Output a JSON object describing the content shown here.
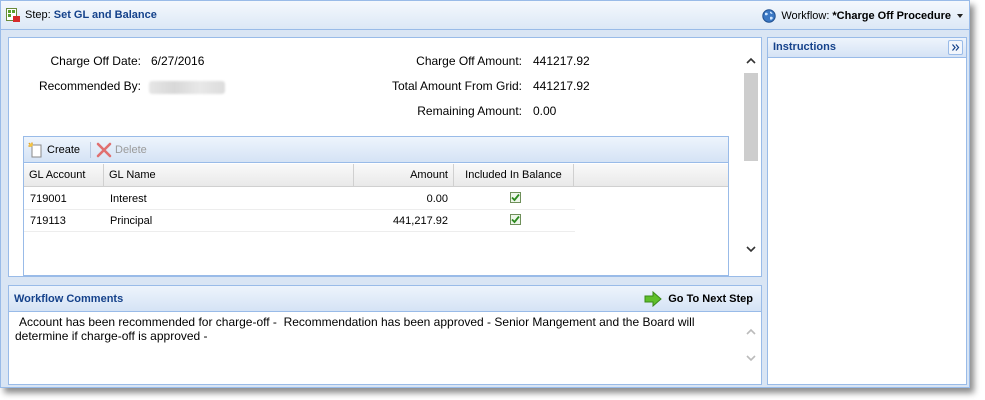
{
  "header": {
    "step_prefix": "Step:",
    "step_title": "Set GL and Balance",
    "workflow_label": "Workflow:",
    "workflow_name": "*Charge Off Procedure"
  },
  "summary": {
    "charge_off_date_label": "Charge Off Date:",
    "charge_off_date": "6/27/2016",
    "recommended_by_label": "Recommended By:",
    "charge_off_amount_label": "Charge Off Amount:",
    "charge_off_amount": "441217.92",
    "total_from_grid_label": "Total Amount From Grid:",
    "total_from_grid": "441217.92",
    "remaining_label": "Remaining Amount:",
    "remaining": "0.00"
  },
  "grid": {
    "toolbar": {
      "create_label": "Create",
      "delete_label": "Delete"
    },
    "columns": [
      "GL Account",
      "GL Name",
      "Amount",
      "Included In Balance"
    ],
    "rows": [
      {
        "account": "719001",
        "name": "Interest",
        "amount": "0.00",
        "included": true
      },
      {
        "account": "719113",
        "name": "Principal",
        "amount": "441,217.92",
        "included": true
      }
    ]
  },
  "comments": {
    "title": "Workflow Comments",
    "next_step_label": "Go To Next Step",
    "text": "Account has been recommended for charge-off -  Recommendation has been approved - Senior Mangement and the Board will determine if charge-off is approved -"
  },
  "instructions": {
    "title": "Instructions"
  },
  "colors": {
    "panel_border": "#99bbe8",
    "header_text": "#15428b",
    "background": "#d9e5f4"
  }
}
